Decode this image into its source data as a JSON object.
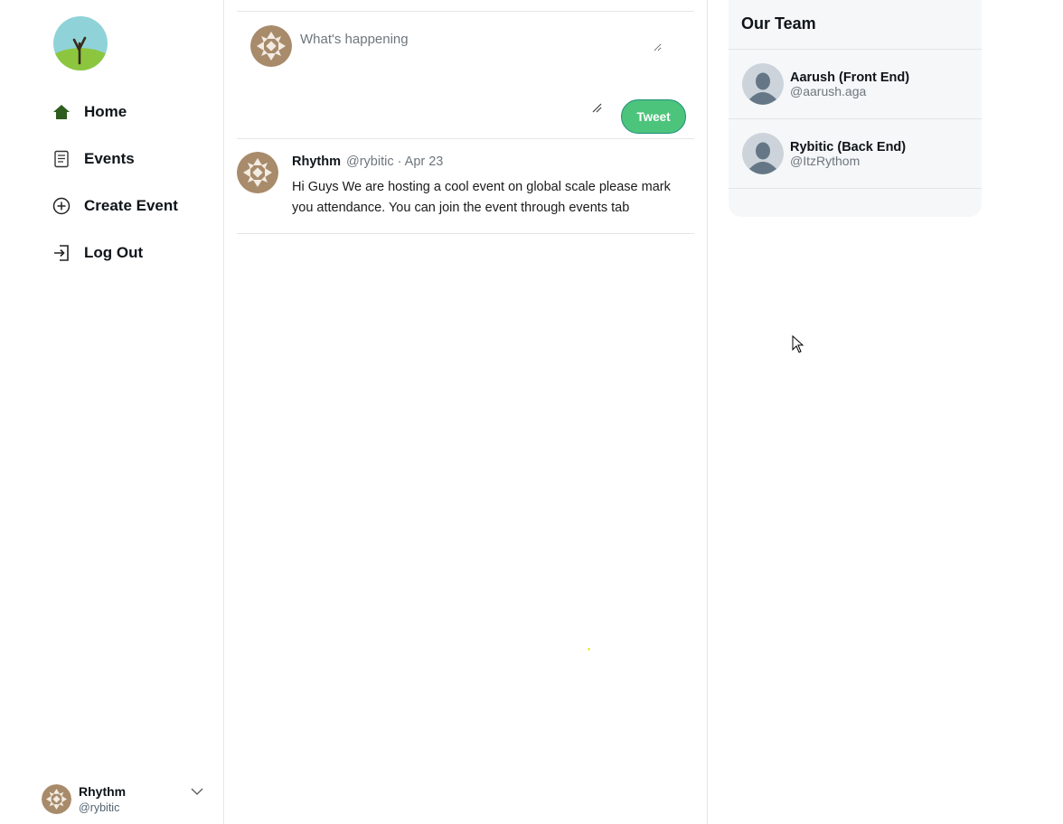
{
  "sidebar": {
    "logo_icon": "tree-logo-icon",
    "items": [
      {
        "label": "Home",
        "icon": "home-icon"
      },
      {
        "label": "Events",
        "icon": "document-icon"
      },
      {
        "label": "Create Event",
        "icon": "plus-circle-icon"
      },
      {
        "label": "Log Out",
        "icon": "logout-icon"
      }
    ],
    "profile": {
      "name": "Rhythm",
      "handle": "@rybitic"
    }
  },
  "composer": {
    "placeholder": "What's happening",
    "tweet_label": "Tweet"
  },
  "posts": [
    {
      "author": "Rhythm",
      "meta": "@rybitic · Apr 23",
      "body": "Hi Guys We are hosting a cool event on global scale please mark you attendance. You can join the event through events tab"
    }
  ],
  "team": {
    "title": "Our Team",
    "members": [
      {
        "name": "Aarush (Front End)",
        "handle": "@aarush.aga"
      },
      {
        "name": "Rybitic (Back End)",
        "handle": "@ItzRythom"
      }
    ]
  },
  "colors": {
    "accent_green": "#4dc47b",
    "avatar_brown": "#a88b6b",
    "panel_bg": "#f5f7f9"
  }
}
